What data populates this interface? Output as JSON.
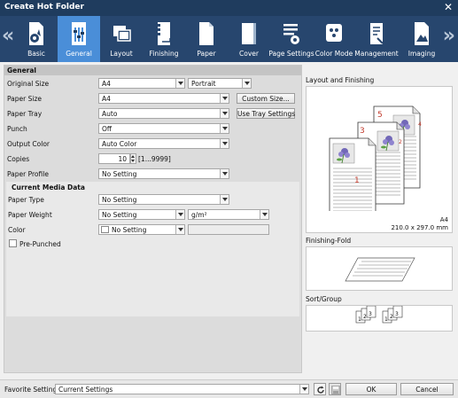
{
  "window": {
    "title": "Create Hot Folder",
    "close": "✕"
  },
  "toolbar": {
    "tabs": [
      {
        "label": "Basic"
      },
      {
        "label": "General"
      },
      {
        "label": "Layout"
      },
      {
        "label": "Finishing"
      },
      {
        "label": "Paper"
      },
      {
        "label": "Cover"
      },
      {
        "label": "Page Settings"
      },
      {
        "label": "Color Mode"
      },
      {
        "label": "Management"
      },
      {
        "label": "Imaging"
      }
    ],
    "active_tab": "General",
    "prev_arrow": "«",
    "next_arrow": "»"
  },
  "general": {
    "header": "General",
    "original_size": {
      "label": "Original Size",
      "value": "A4",
      "orientation": "Portrait"
    },
    "paper_size": {
      "label": "Paper Size",
      "value": "A4",
      "button": "Custom Size..."
    },
    "paper_tray": {
      "label": "Paper Tray",
      "value": "Auto",
      "button": "Use Tray Settings"
    },
    "punch": {
      "label": "Punch",
      "value": "Off"
    },
    "output_color": {
      "label": "Output Color",
      "value": "Auto Color"
    },
    "copies": {
      "label": "Copies",
      "value": "10",
      "range": "[1...9999]"
    },
    "paper_profile": {
      "label": "Paper Profile",
      "value": "No Setting"
    }
  },
  "media": {
    "header": "Current Media Data",
    "paper_type": {
      "label": "Paper Type",
      "value": "No Setting"
    },
    "paper_weight": {
      "label": "Paper Weight",
      "value": "No Setting",
      "unit": "g/m²"
    },
    "color": {
      "label": "Color",
      "value": "No Setting"
    },
    "pre_punched": {
      "label": "Pre-Punched",
      "checked": false
    }
  },
  "preview": {
    "layout_title": "Layout and Finishing",
    "page_numbers": [
      "5",
      "4",
      "3",
      "2",
      "1"
    ],
    "size_name": "A4",
    "size_dims": "210.0 x 297.0 mm",
    "fold_title": "Finishing-Fold",
    "sort_title": "Sort/Group",
    "sort_numbers": [
      "1",
      "2",
      "3",
      "1",
      "2",
      "3"
    ]
  },
  "footer": {
    "favorite_label": "Favorite Setting",
    "favorite_value": "Current Settings",
    "ok": "OK",
    "cancel": "Cancel"
  },
  "colors": {
    "titlebar": "#1f3c5e",
    "toolbar": "#27466e",
    "active_tab": "#4a8ed8",
    "page_number": "#c0392b"
  }
}
